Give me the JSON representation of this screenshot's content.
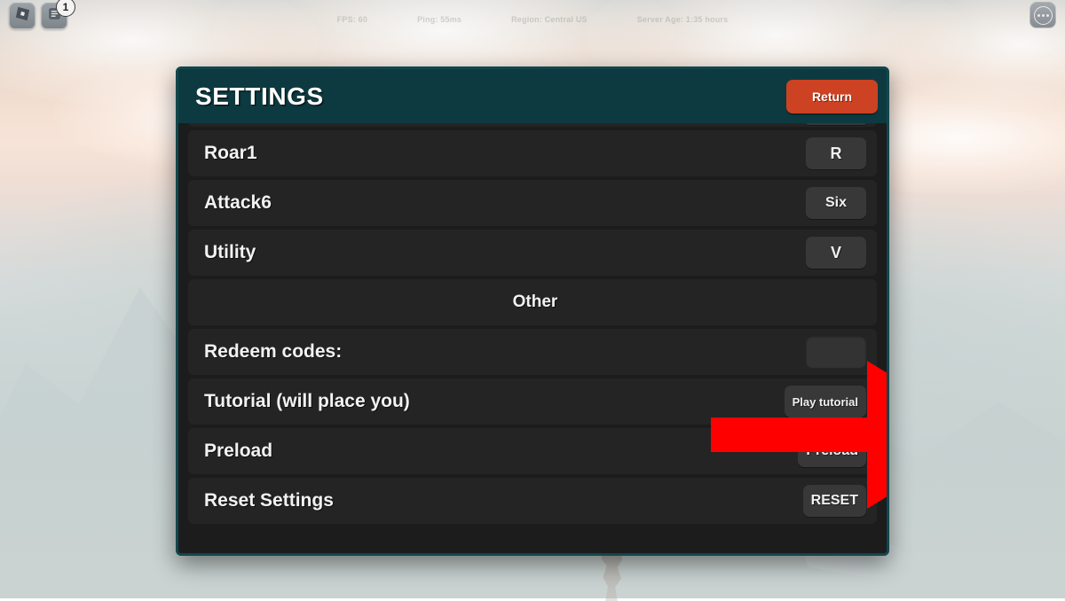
{
  "topbar": {
    "roblox_icon": "roblox-logo-icon",
    "chat_icon": "chat-document-icon",
    "chat_badge": "1",
    "menu_icon": "three-dots-icon",
    "stats": [
      "FPS: 60",
      "Ping: 55ms",
      "Region: Central US",
      "Server Age: 1:35 hours"
    ]
  },
  "panel": {
    "title": "SETTINGS",
    "return_label": "Return"
  },
  "rows": [
    {
      "label": "",
      "action": "",
      "type": "partial",
      "size": "sm"
    },
    {
      "label": "Roar1",
      "action": "R",
      "type": "keybind",
      "size": "lg"
    },
    {
      "label": "Attack6",
      "action": "Six",
      "type": "keybind",
      "size": "md"
    },
    {
      "label": "Utility",
      "action": "V",
      "type": "keybind",
      "size": "lg"
    },
    {
      "label": "Other",
      "action": "",
      "type": "section",
      "size": "md"
    },
    {
      "label": "Redeem codes:",
      "action": "",
      "type": "input",
      "size": "md"
    },
    {
      "label": "Tutorial (will place you)",
      "action": "Play tutorial",
      "type": "button",
      "size": "sm"
    },
    {
      "label": "Preload",
      "action": "Preload",
      "type": "button",
      "size": "md"
    },
    {
      "label": "Reset Settings",
      "action": "RESET",
      "type": "button",
      "size": "md"
    }
  ],
  "annotation": {
    "arrow_color": "#fe0000",
    "points_to": "redeem-codes-input"
  },
  "colors": {
    "header_teal": "#0d3a40",
    "panel_border": "#12464d",
    "panel_bg": "#1c1c1c",
    "row_bg": "#242424",
    "return_orange": "#cc4222",
    "action_bg": "#383838"
  }
}
